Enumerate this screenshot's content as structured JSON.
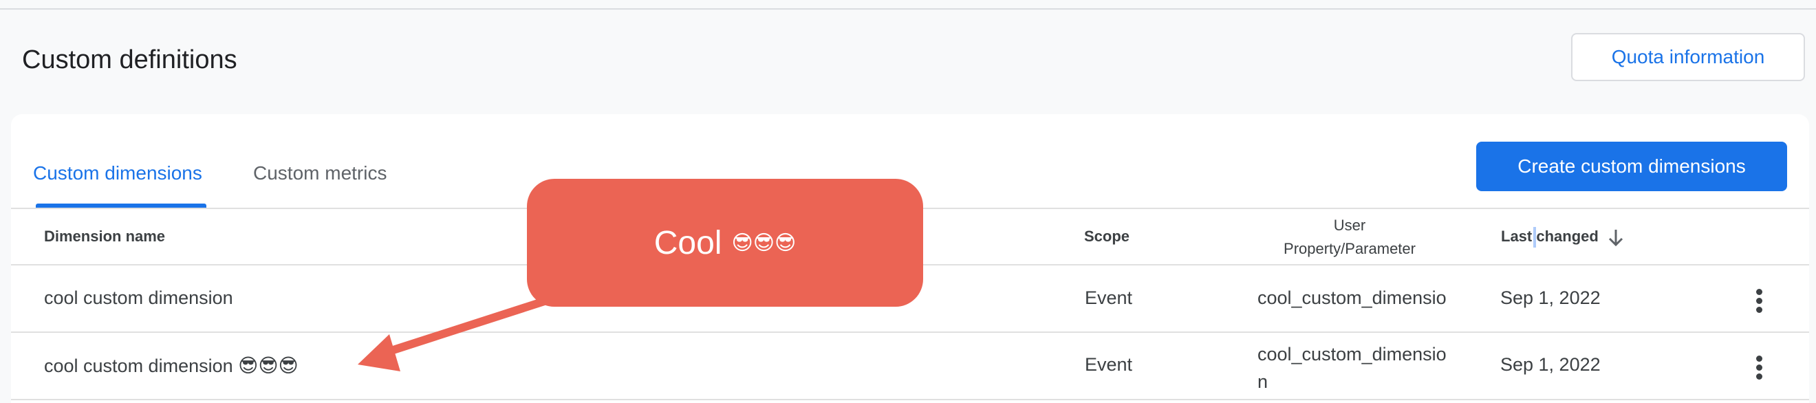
{
  "page": {
    "title": "Custom definitions",
    "quota_button": "Quota information"
  },
  "tabs": [
    {
      "label": "Custom dimensions",
      "active": true
    },
    {
      "label": "Custom metrics",
      "active": false
    }
  ],
  "create_button": "Create custom dimensions",
  "table": {
    "headers": {
      "name": "Dimension name",
      "scope": "Scope",
      "user_prop_line1": "User",
      "user_prop_line2": "Property/Parameter",
      "last_changed": "Last changed"
    },
    "rows": [
      {
        "name": "cool custom dimension",
        "name_emoji": "",
        "scope": "Event",
        "param_line1": "cool_custom_dimensio",
        "param_line2": "",
        "last_changed": "Sep 1, 2022"
      },
      {
        "name": "cool custom dimension",
        "name_emoji": "😎😎😎",
        "scope": "Event",
        "param_line1": "cool_custom_dimensio",
        "param_line2": "n",
        "last_changed": "Sep 1, 2022"
      }
    ]
  },
  "annotation": {
    "text": "Cool",
    "emoji": "😎😎😎",
    "color": "#eb6454"
  },
  "icons": {
    "sort": "arrow-down-icon",
    "row_menu": "more-vert-icon"
  },
  "colors": {
    "accent": "#1a73e8",
    "background": "#f8f9fa"
  }
}
